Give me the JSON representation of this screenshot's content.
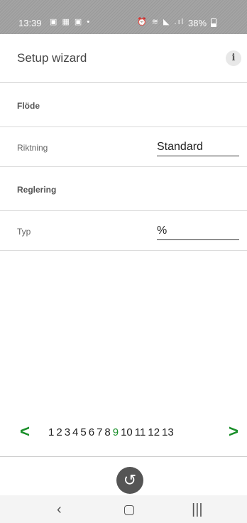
{
  "status_bar": {
    "time": "13:39",
    "battery": "38%"
  },
  "app_bar": {
    "title": "Setup wizard",
    "info_icon": "i"
  },
  "sections": {
    "flode": {
      "header": "Flöde",
      "riktning_label": "Riktning",
      "riktning_value": "Standard"
    },
    "reglering": {
      "header": "Reglering",
      "typ_label": "Typ",
      "typ_value": "%"
    }
  },
  "pager": {
    "prev": "<",
    "next": ">",
    "pages": [
      "1",
      "2",
      "3",
      "4",
      "5",
      "6",
      "7",
      "8",
      "9",
      "10",
      "11",
      "12",
      "13"
    ],
    "current": "9"
  },
  "colors": {
    "accent_green": "#1a8f2a"
  },
  "icons": {
    "back_fab": "undo-icon",
    "nav_back": "nav-back-icon",
    "nav_home": "nav-home-icon",
    "nav_recents": "nav-recents-icon"
  }
}
